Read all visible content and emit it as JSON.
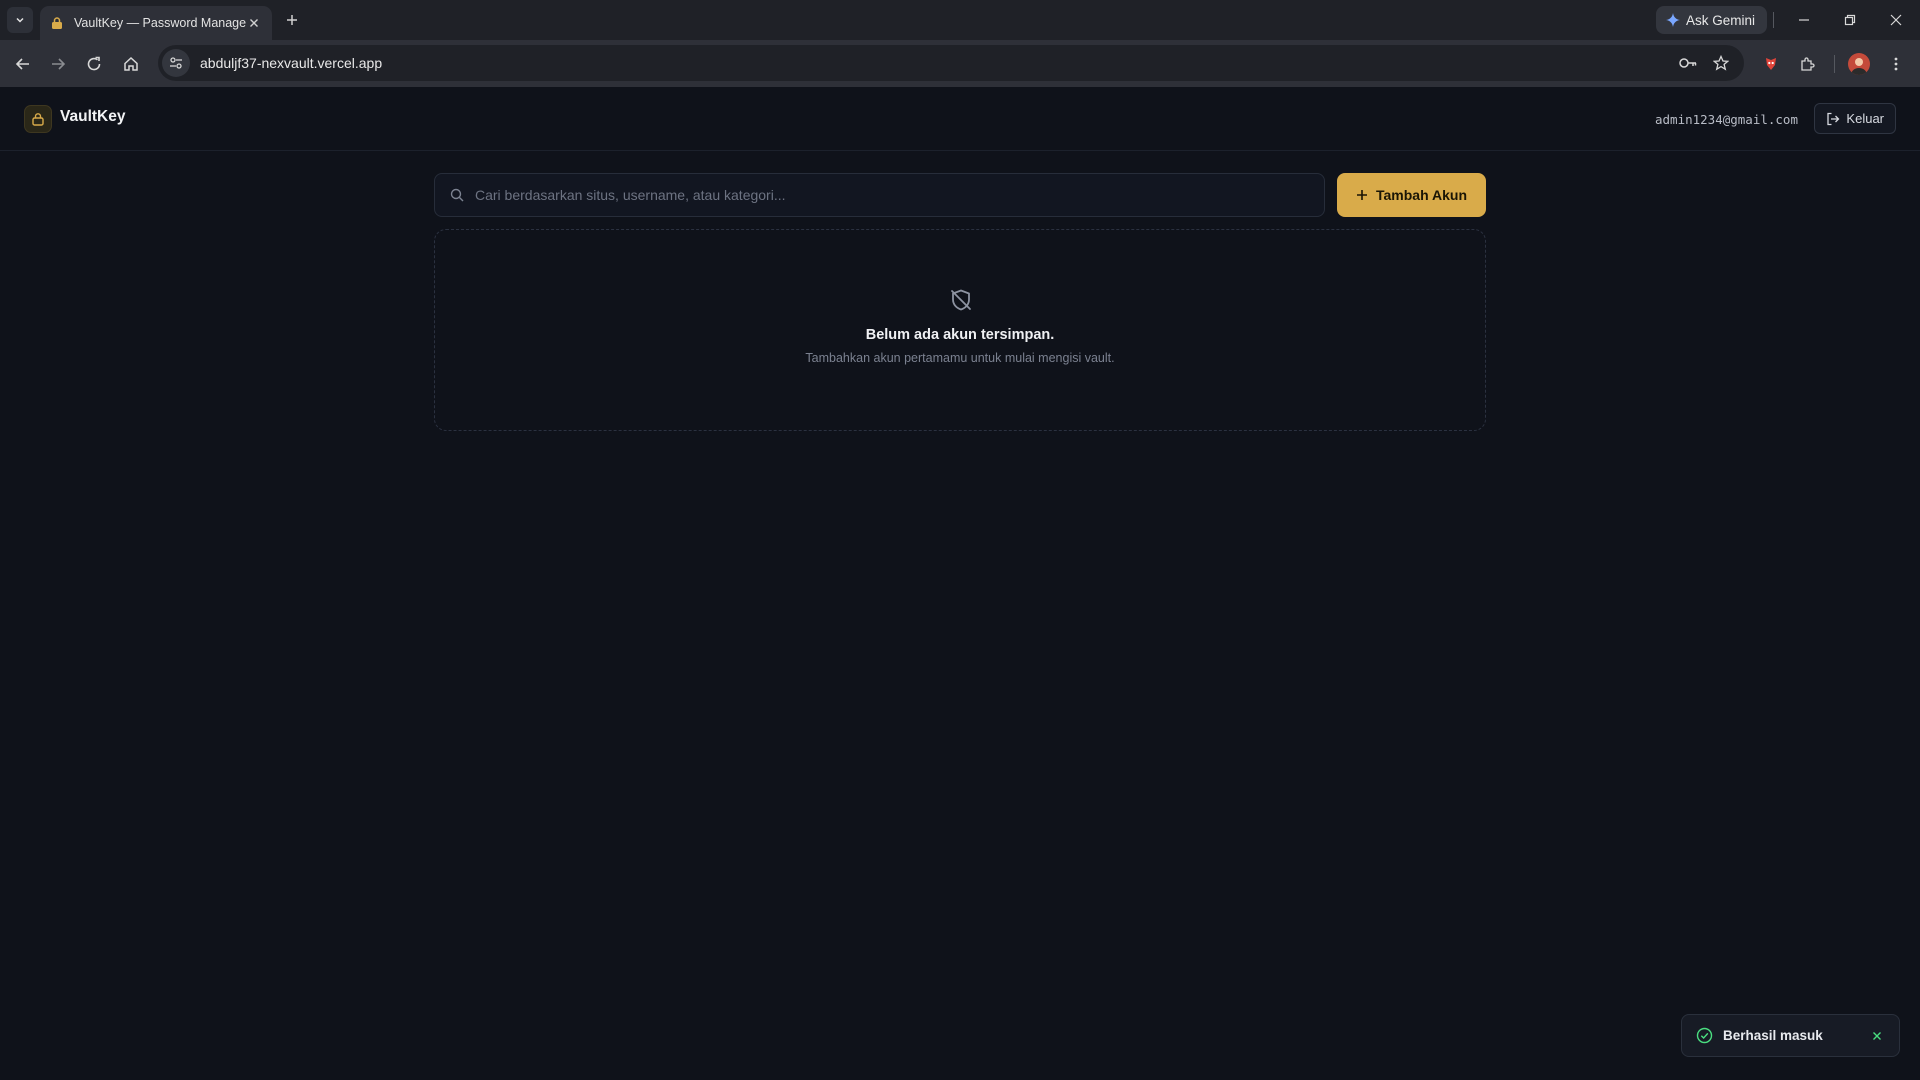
{
  "browser": {
    "tab_title": "VaultKey — Password Manager",
    "url": "abduljf37-nexvault.vercel.app",
    "ask_gemini_label": "Ask Gemini"
  },
  "header": {
    "brand": "VaultKey",
    "user_email": "admin1234@gmail.com",
    "logout_label": "Keluar"
  },
  "search": {
    "placeholder": "Cari berdasarkan situs, username, atau kategori...",
    "value": ""
  },
  "add_button_label": "Tambah Akun",
  "empty_state": {
    "title": "Belum ada akun tersimpan.",
    "subtitle": "Tambahkan akun pertamamu untuk mulai mengisi vault."
  },
  "toast": {
    "message": "Berhasil masuk"
  },
  "colors": {
    "accent": "#d9ab4a",
    "background": "#0f121a",
    "success": "#4ade80"
  }
}
